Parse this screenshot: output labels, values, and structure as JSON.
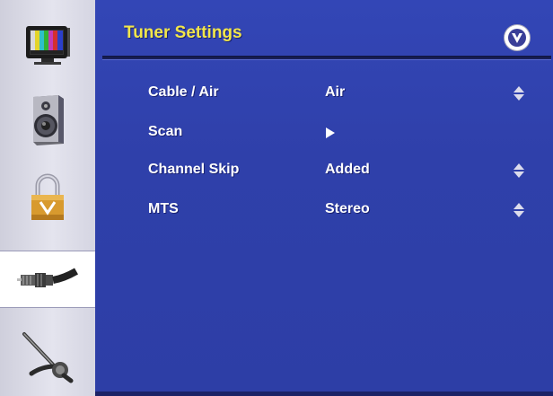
{
  "sidebar": {
    "items": [
      {
        "icon": "tv-picture-icon",
        "active": false
      },
      {
        "icon": "speaker-audio-icon",
        "active": false
      },
      {
        "icon": "padlock-icon",
        "active": false
      },
      {
        "icon": "coax-cable-icon",
        "active": true
      },
      {
        "icon": "tool-setup-icon",
        "active": false
      }
    ]
  },
  "header": {
    "title": "Tuner Settings",
    "badge_icon": "vizio-v-logo-icon"
  },
  "menu": {
    "rows": [
      {
        "label": "Cable / Air",
        "value": "Air",
        "control": "updown-arrows-icon"
      },
      {
        "label": "Scan",
        "value": "",
        "control": "submenu-arrow-icon"
      },
      {
        "label": "Channel Skip",
        "value": "Added",
        "control": "updown-arrows-icon"
      },
      {
        "label": "MTS",
        "value": "Stereo",
        "control": "updown-arrows-icon"
      }
    ]
  },
  "colors": {
    "panel": "#2d3ea9",
    "title": "#f2e64a",
    "text": "#ffffff",
    "sidebar": "#dcdce8"
  }
}
